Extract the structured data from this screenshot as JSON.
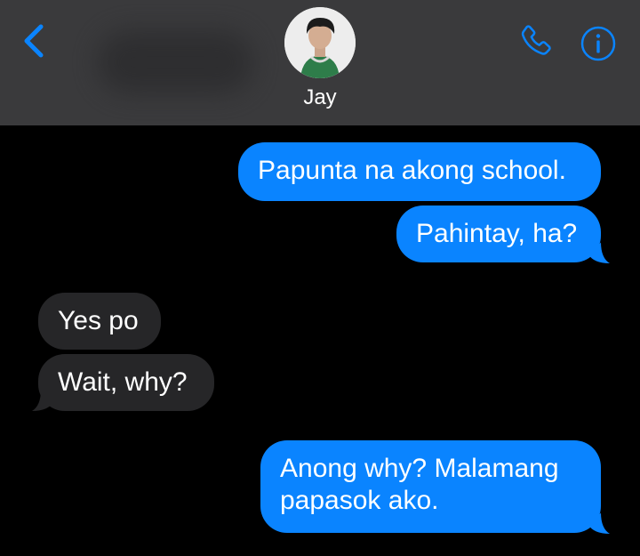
{
  "header": {
    "contact_name": "Jay",
    "back_icon": "chevron-left-icon",
    "call_icon": "phone-icon",
    "info_icon": "info-icon",
    "accent_color": "#0a84ff"
  },
  "messages": [
    {
      "direction": "sent",
      "text": "Papunta na akong school."
    },
    {
      "direction": "sent",
      "text": "Pahintay, ha?"
    },
    {
      "direction": "received",
      "text": "Yes po"
    },
    {
      "direction": "received",
      "text": "Wait, why?"
    },
    {
      "direction": "sent",
      "text_lines": [
        "Anong why? Malamang",
        "papasok ako."
      ]
    }
  ],
  "colors": {
    "sent_bubble": "#0a84ff",
    "received_bubble": "#262628",
    "background": "#000000",
    "header": "#3a3a3c"
  }
}
